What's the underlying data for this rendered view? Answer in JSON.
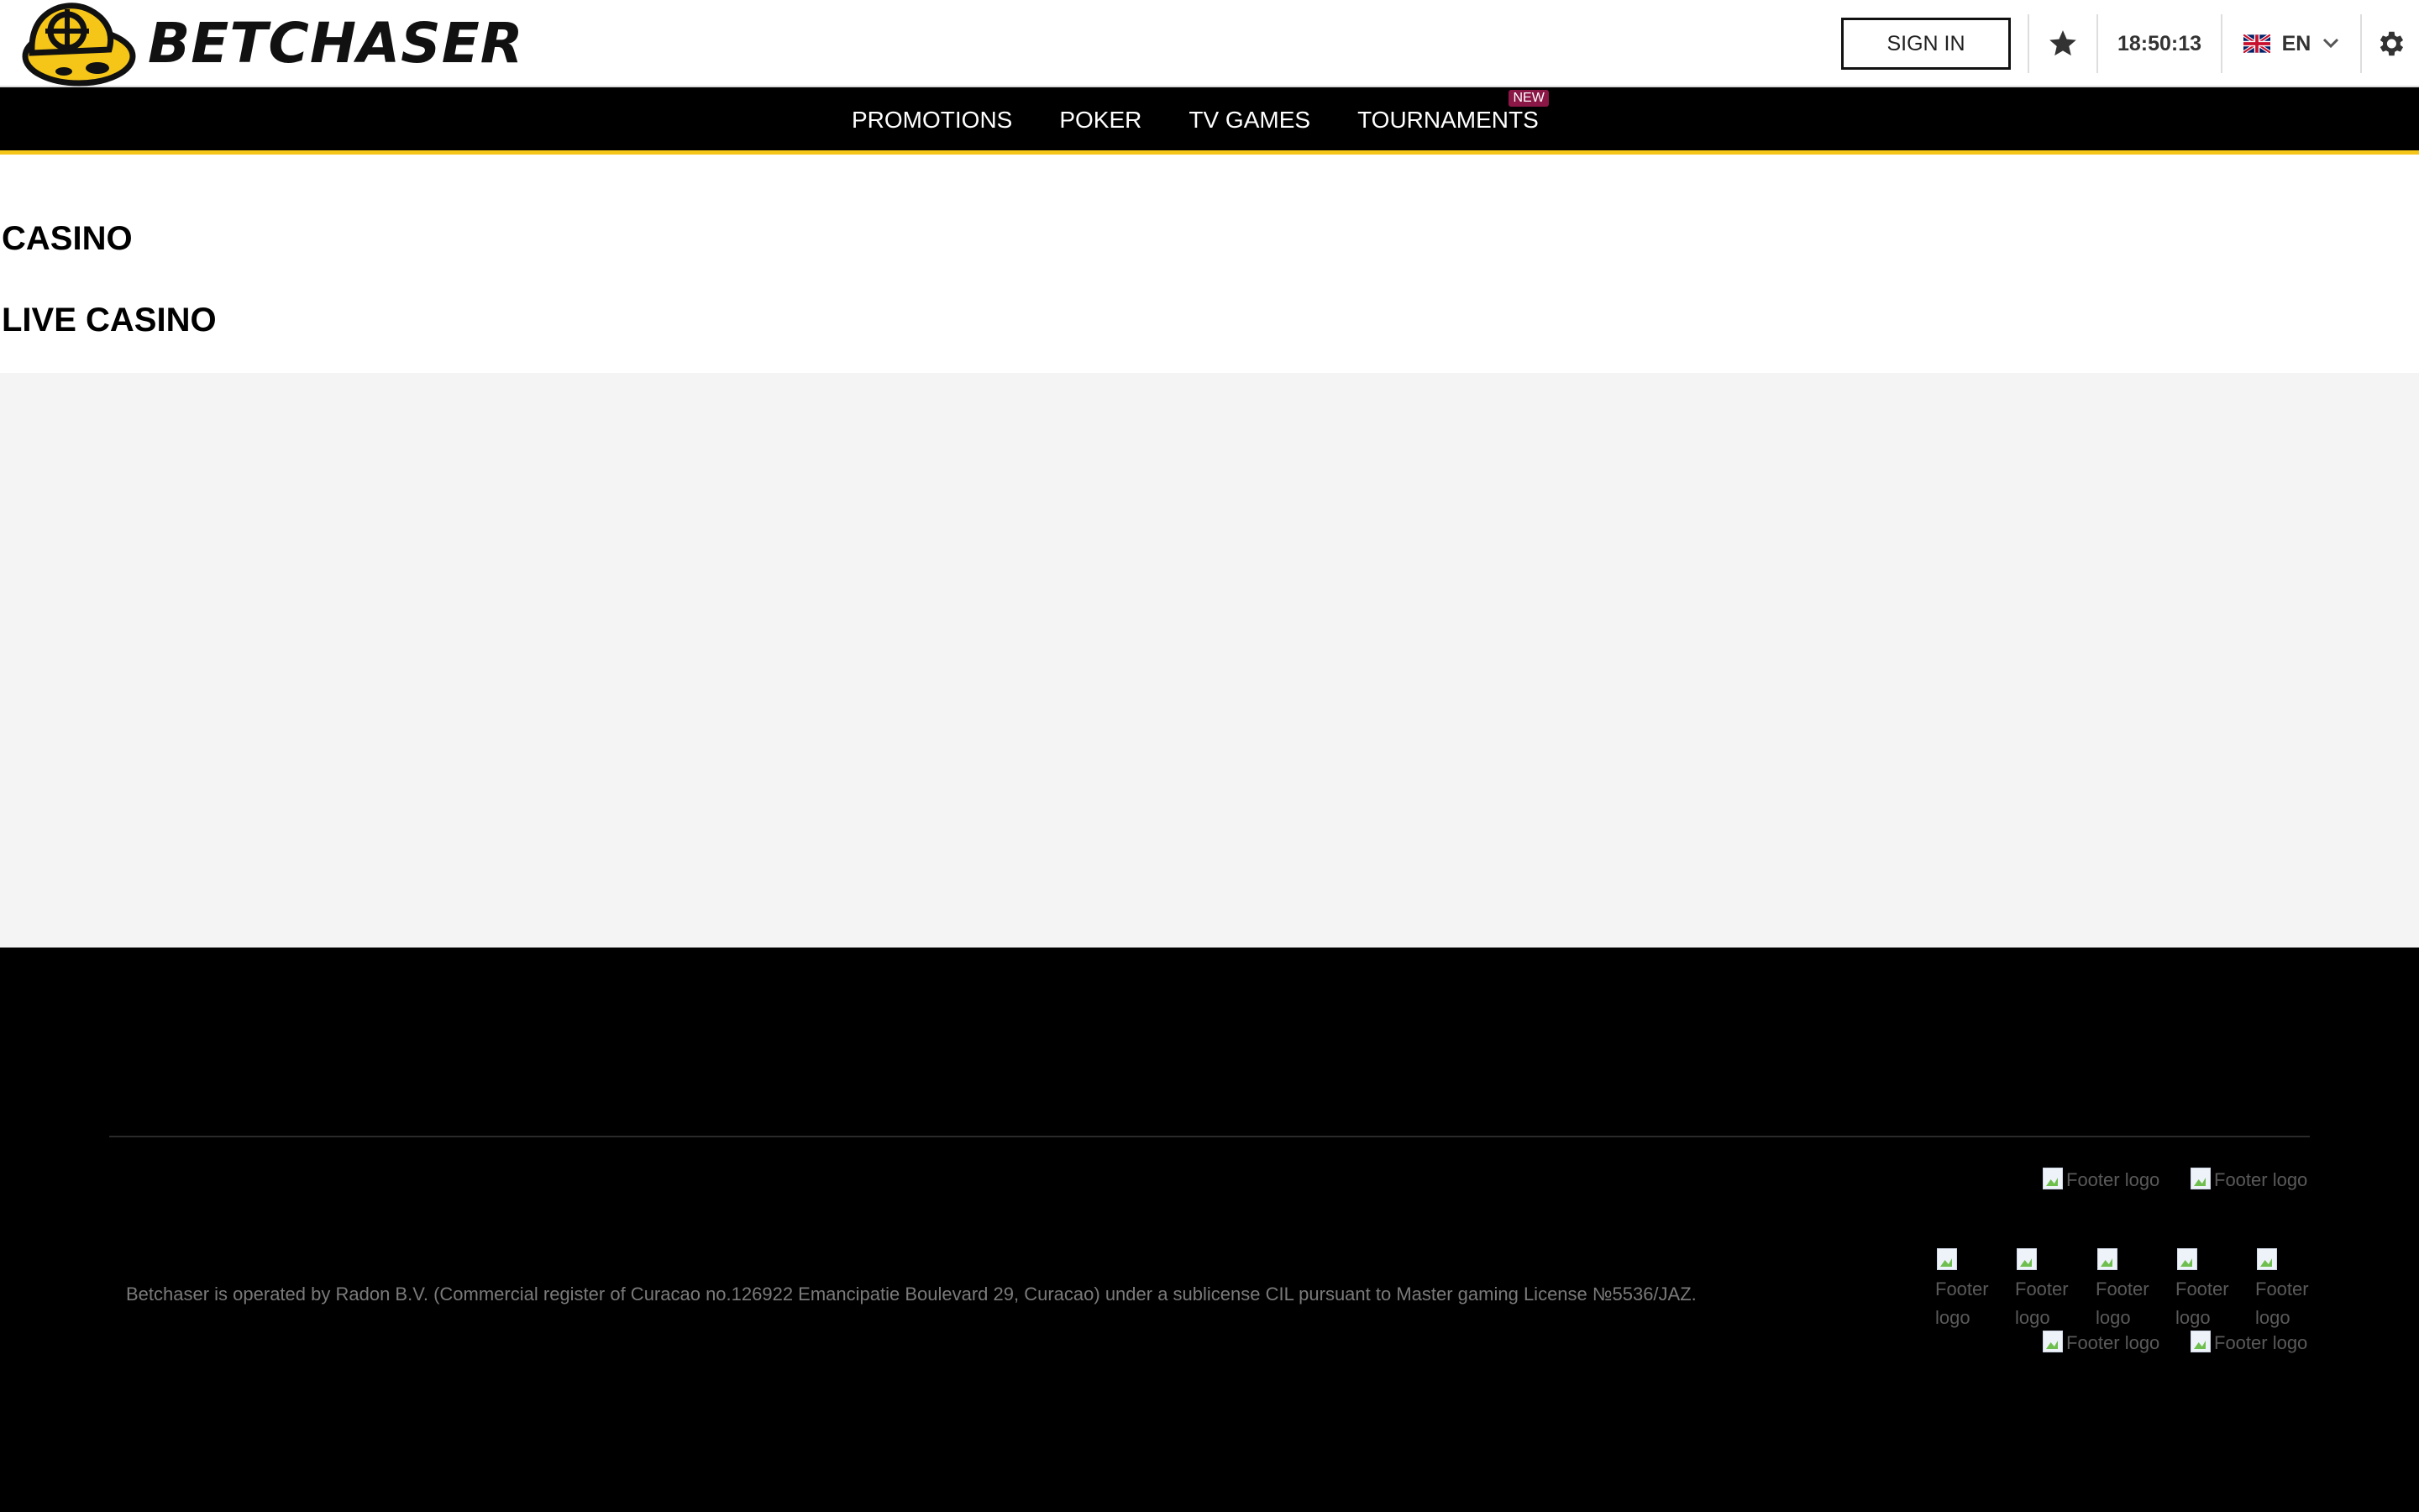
{
  "header": {
    "brand": "BETCHASER",
    "sign_in_label": "SIGN IN",
    "clock": "18:50:13",
    "language": "EN",
    "icons": {
      "logo": "betchaser-logo-icon",
      "favorites": "star-icon",
      "flag": "uk-flag-icon",
      "dropdown": "chevron-down-icon",
      "settings": "gear-icon"
    }
  },
  "nav": {
    "items": [
      {
        "label": "PROMOTIONS"
      },
      {
        "label": "POKER"
      },
      {
        "label": "TV GAMES"
      },
      {
        "label": "TOURNAMENTS",
        "badge": "NEW"
      }
    ]
  },
  "sections": {
    "casino": "CASINO",
    "live_casino": "LIVE CASINO"
  },
  "footer": {
    "legal_text": "Betchaser is operated by Radon B.V. (Commercial register of Curacao no.126922 Emancipatie Boulevard 29, Curacao) under a sublicense CIL pursuant to Master gaming License №5536/JAZ.",
    "logo_alt": "Footer logo",
    "logo_alt_line1": "Footer",
    "logo_alt_line2": "logo"
  },
  "colors": {
    "accent": "#f5c518",
    "nav_bg": "#000000",
    "badge_new": "#8a1746",
    "content_bg": "#f4f4f4",
    "footer_bg": "#000000"
  }
}
